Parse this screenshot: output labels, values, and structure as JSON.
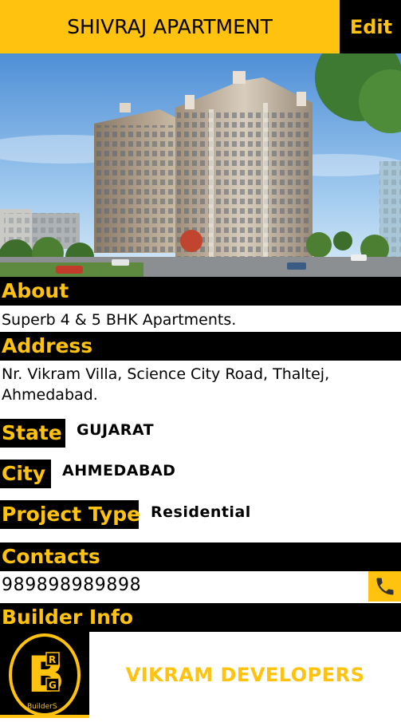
{
  "header": {
    "title": "SHIVRAJ APARTMENT",
    "edit_label": "Edit"
  },
  "about": {
    "heading": "About",
    "text": "Superb 4 & 5 BHK Apartments."
  },
  "address": {
    "heading": "Address",
    "text": "Nr. Vikram Villa, Science City Road, Thaltej, Ahmedabad."
  },
  "state": {
    "label": "State",
    "value": "GUJARAT"
  },
  "city": {
    "label": "City",
    "value": "AHMEDABAD"
  },
  "project_type": {
    "label": "Project Type",
    "value": "Residential"
  },
  "contacts": {
    "heading": "Contacts",
    "phone": "989898989898",
    "call_icon": "phone-icon"
  },
  "builder": {
    "heading": "Builder Info",
    "name": "VIKRAM DEVELOPERS",
    "logo_text": "BuilderS"
  },
  "colors": {
    "accent": "#FFC20E",
    "dark": "#000000"
  }
}
